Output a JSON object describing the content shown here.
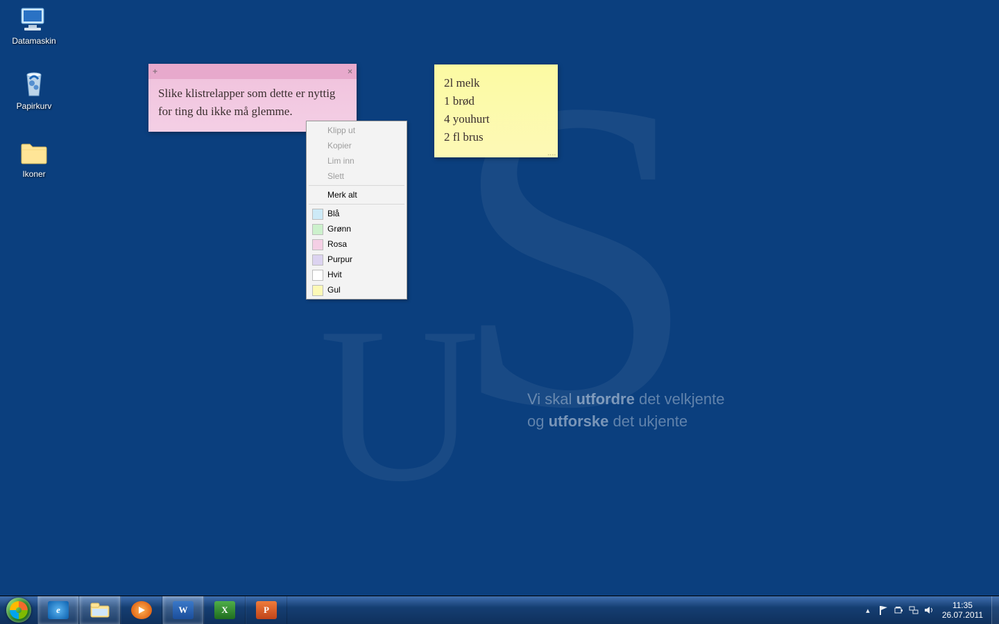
{
  "wallpaper": {
    "slogan_pre1": "Vi skal ",
    "slogan_b1": "utfordre",
    "slogan_post1": " det velkjente",
    "slogan_pre2": "og ",
    "slogan_b2": "utforske",
    "slogan_post2": " det ukjente"
  },
  "desktop_icons": {
    "computer": "Datamaskin",
    "recycle": "Papirkurv",
    "folder": "Ikoner"
  },
  "note_pink": {
    "text": "Slike klistrelapper som dette er nyttig for ting du ikke må glemme.",
    "add": "+",
    "close": "×"
  },
  "note_yellow": {
    "text": "2l melk\n1 brød\n4 youhurt\n2 fl brus"
  },
  "context_menu": {
    "cut": "Klipp ut",
    "copy": "Kopier",
    "paste": "Lim inn",
    "delete": "Slett",
    "select_all": "Merk alt",
    "colors": {
      "blue": {
        "label": "Blå",
        "hex": "#cdeaf7"
      },
      "green": {
        "label": "Grønn",
        "hex": "#ccf1cc"
      },
      "pink": {
        "label": "Rosa",
        "hex": "#f4cfe5"
      },
      "purple": {
        "label": "Purpur",
        "hex": "#dcd3f0"
      },
      "white": {
        "label": "Hvit",
        "hex": "#ffffff"
      },
      "yellow": {
        "label": "Gul",
        "hex": "#fdf9b6"
      }
    }
  },
  "taskbar": {
    "ie": "e",
    "word": "W",
    "excel": "X",
    "ppt": "P"
  },
  "tray": {
    "arrow": "▴",
    "time": "11:35",
    "date": "26.07.2011"
  }
}
